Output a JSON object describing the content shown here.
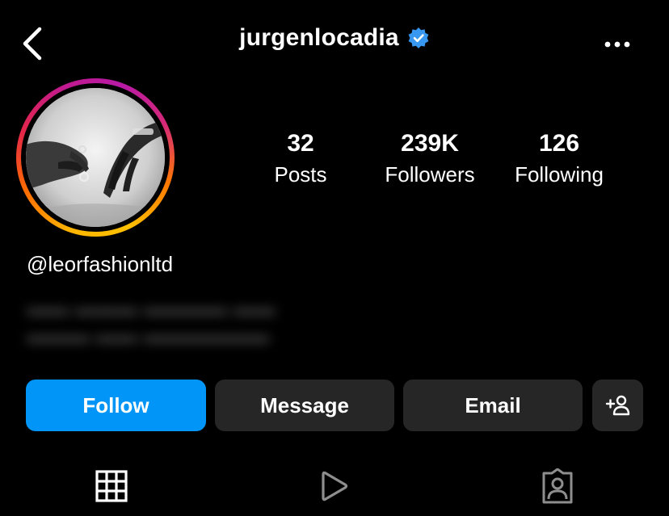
{
  "header": {
    "back_icon": "chevron-left-icon",
    "username": "jurgenlocadia",
    "verified_icon": "verified-badge-icon",
    "more_icon": "more-horizontal-icon"
  },
  "profile": {
    "avatar_description": "profile-photo"
  },
  "stats": [
    {
      "value": "32",
      "label": "Posts"
    },
    {
      "value": "239K",
      "label": "Followers"
    },
    {
      "value": "126",
      "label": "Following"
    }
  ],
  "handle": "@leorfashionltd",
  "actions": {
    "follow_label": "Follow",
    "message_label": "Message",
    "email_label": "Email",
    "add_user_icon": "add-user-icon"
  },
  "tabs": {
    "grid_icon": "grid-icon",
    "reels_icon": "play-icon",
    "tagged_icon": "tagged-person-icon"
  },
  "colors": {
    "background": "#000000",
    "follow_button": "#0095f6",
    "secondary_button": "#262626",
    "verified_badge": "#3897f0"
  }
}
